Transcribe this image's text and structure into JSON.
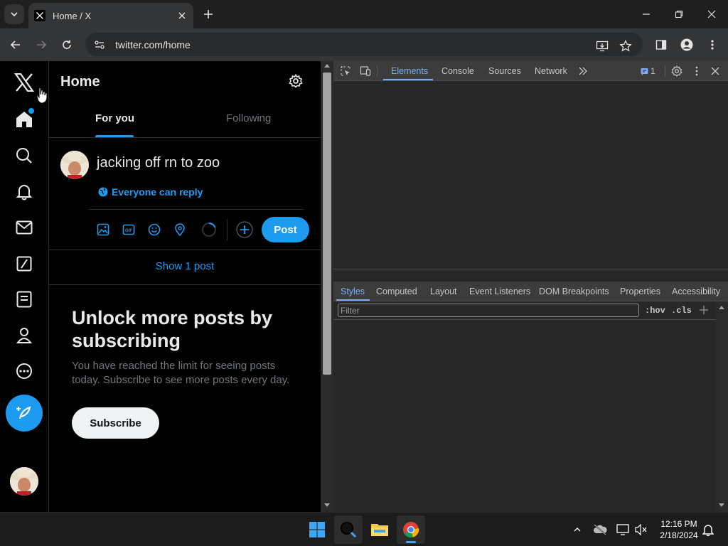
{
  "browser": {
    "tab_title": "Home / X",
    "url": "twitter.com/home"
  },
  "x": {
    "header_title": "Home",
    "tabs": [
      {
        "label": "For you",
        "active": true
      },
      {
        "label": "Following",
        "active": false
      }
    ],
    "composer": {
      "text": "jacking off rn to zoo",
      "reply_setting": "Everyone can reply",
      "post_label": "Post"
    },
    "show_posts": "Show 1 post",
    "unlock": {
      "title": "Unlock more posts by subscribing",
      "description": "You have reached the limit for seeing posts today. Subscribe to see more posts every day.",
      "button": "Subscribe"
    },
    "nav_icons": [
      "x-logo-icon",
      "home-icon",
      "search-icon",
      "bell-icon",
      "mail-icon",
      "grok-icon",
      "lists-icon",
      "profile-icon",
      "more-icon"
    ],
    "accent": "#1d9bf0"
  },
  "devtools": {
    "tabs": [
      "Elements",
      "Console",
      "Sources",
      "Network"
    ],
    "active_tab": "Elements",
    "issues_count": "1",
    "subtabs": [
      "Styles",
      "Computed",
      "Layout",
      "Event Listeners",
      "DOM Breakpoints",
      "Properties",
      "Accessibility"
    ],
    "active_subtab": "Styles",
    "filter_placeholder": "Filter",
    "hov_label": ":hov",
    "cls_label": ".cls"
  },
  "taskbar": {
    "time": "12:16 PM",
    "date": "2/18/2024"
  }
}
